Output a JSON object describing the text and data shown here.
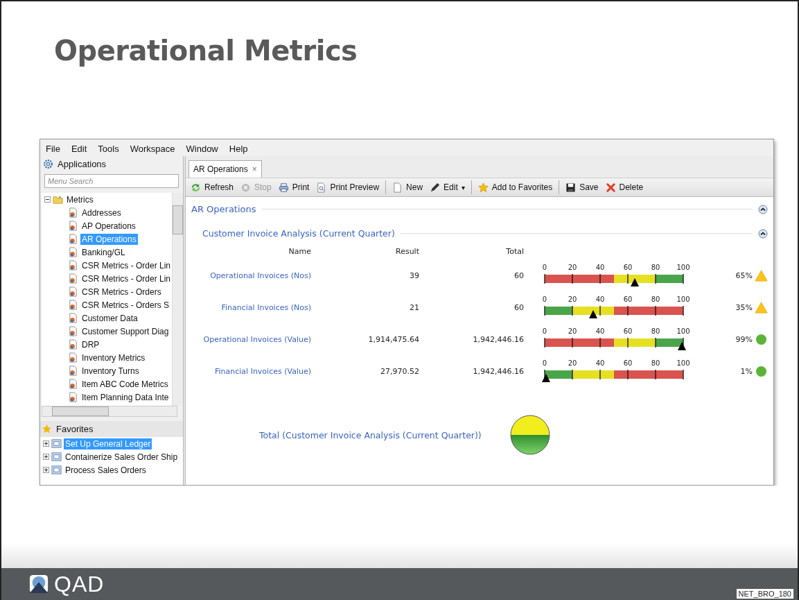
{
  "slide": {
    "title": "Operational Metrics",
    "footer_code": "NET_BRO_180",
    "logo_text": "QAD"
  },
  "menu": [
    "File",
    "Edit",
    "Tools",
    "Workspace",
    "Window",
    "Help"
  ],
  "sidebar": {
    "applications_title": "Applications",
    "search": {
      "placeholder": "Menu Search"
    },
    "tree": [
      {
        "label": "Metrics",
        "expanded": true,
        "selected": false,
        "children": [
          {
            "label": "Addresses",
            "selected": false
          },
          {
            "label": "AP Operations",
            "selected": false
          },
          {
            "label": "AR Operations",
            "selected": true
          },
          {
            "label": "Banking/GL",
            "selected": false
          },
          {
            "label": "CSR Metrics - Order Lin",
            "selected": false
          },
          {
            "label": "CSR Metrics - Order Lin",
            "selected": false
          },
          {
            "label": "CSR Metrics - Orders",
            "selected": false
          },
          {
            "label": "CSR Metrics - Orders S",
            "selected": false
          },
          {
            "label": "Customer Data",
            "selected": false
          },
          {
            "label": "Customer Support Diag",
            "selected": false
          },
          {
            "label": "DRP",
            "selected": false
          },
          {
            "label": "Inventory Metrics",
            "selected": false
          },
          {
            "label": "Inventory Turns",
            "selected": false
          },
          {
            "label": "Item ABC Code Metrics",
            "selected": false
          },
          {
            "label": "Item Planning Data Inte",
            "selected": false
          }
        ]
      }
    ],
    "favorites_title": "Favorites",
    "favorites": [
      {
        "label": "Set Up General Ledger",
        "selected": true,
        "expanded": false
      },
      {
        "label": "Containerize Sales Order Ship",
        "selected": false,
        "expanded": false
      },
      {
        "label": "Process Sales Orders",
        "selected": false,
        "expanded": false
      }
    ]
  },
  "tabs": [
    {
      "label": "AR Operations",
      "selected": true,
      "close": "×"
    }
  ],
  "toolbar_groups": [
    [
      {
        "label": "Refresh",
        "disabled": false
      },
      {
        "label": "Stop",
        "disabled": true
      },
      {
        "label": "Print",
        "disabled": false
      },
      {
        "label": "Print Preview",
        "disabled": false
      }
    ],
    [
      {
        "label": "New",
        "disabled": false
      },
      {
        "label": "Edit",
        "disabled": false,
        "arrow": "▾"
      }
    ],
    [
      {
        "label": "Add to Favorites",
        "disabled": false
      }
    ],
    [
      {
        "label": "Save",
        "disabled": false
      },
      {
        "label": "Delete",
        "disabled": false
      }
    ]
  ],
  "section_title": "AR Operations",
  "analysis": {
    "title": "Customer Invoice Analysis (Current Quarter)",
    "columns": [
      "Name",
      "Result",
      "Total"
    ],
    "rows": [
      {
        "name": "Operational Invoices (Nos)",
        "result": "39",
        "total": "60",
        "gauge": {
          "kind": "higher_better",
          "level": 0.65,
          "ticks": [
            "0",
            "20",
            "40",
            "60",
            "80",
            "100"
          ]
        },
        "percent": "65%",
        "indicator": {
          "kind": "warning"
        }
      },
      {
        "name": "Financial Invoices (Nos)",
        "result": "21",
        "total": "60",
        "gauge": {
          "kind": "lower_better",
          "level": 0.35,
          "ticks": [
            "0",
            "20",
            "40",
            "60",
            "80",
            "100"
          ]
        },
        "percent": "35%",
        "indicator": {
          "kind": "warning"
        }
      },
      {
        "name": "Operational Invoices (Value)",
        "result": "1,914,475.64",
        "total": "1,942,446.16",
        "gauge": {
          "kind": "higher_better",
          "level": 0.99,
          "ticks": [
            "0",
            "20",
            "40",
            "60",
            "80",
            "100"
          ]
        },
        "percent": "99%",
        "indicator": {
          "kind": "ok"
        }
      },
      {
        "name": "Financial Invoices (Value)",
        "result": "27,970.52",
        "total": "1,942,446.16",
        "gauge": {
          "kind": "lower_better",
          "level": 0.01,
          "ticks": [
            "0",
            "20",
            "40",
            "60",
            "80",
            "100"
          ]
        },
        "percent": "1%",
        "indicator": {
          "kind": "ok"
        }
      }
    ],
    "total_label": "Total (Customer Invoice Analysis (Current Quarter))"
  }
}
